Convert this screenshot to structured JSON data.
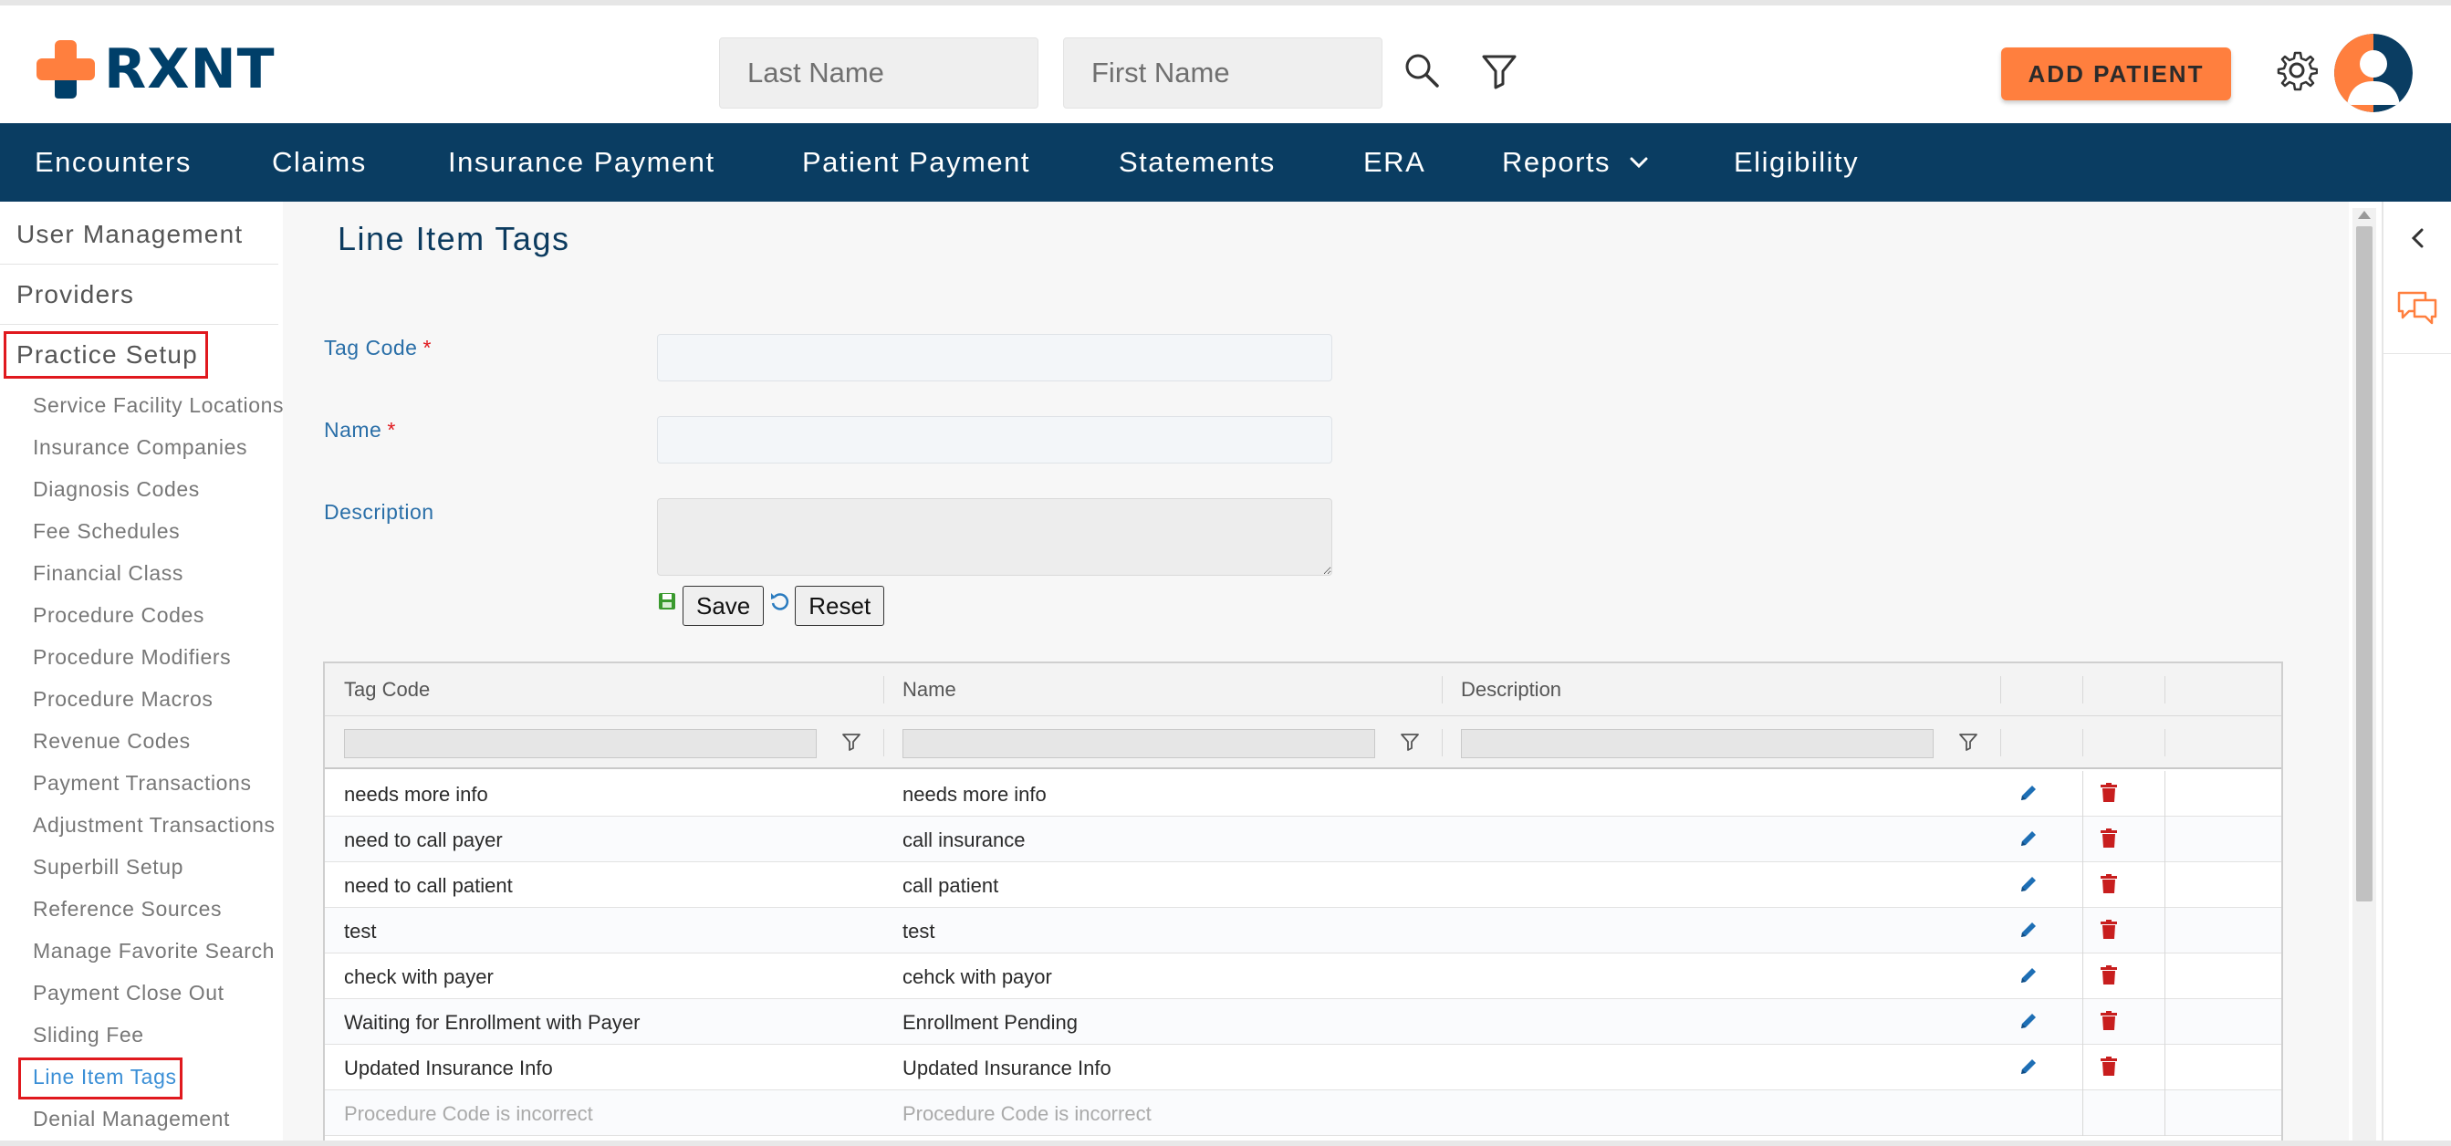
{
  "app": {
    "logo_text": "RXNT",
    "brand_color": "#003f69",
    "accent_color": "#ff7f3e",
    "nav_color": "#0a3d62"
  },
  "header": {
    "last_name_placeholder": "Last Name",
    "first_name_placeholder": "First Name",
    "add_patient_label": "ADD PATIENT",
    "icons": [
      "search-icon",
      "filter-icon",
      "gear-icon",
      "avatar"
    ]
  },
  "nav": {
    "items": [
      {
        "label": "Encounters"
      },
      {
        "label": "Claims"
      },
      {
        "label": "Insurance Payment"
      },
      {
        "label": "Patient Payment"
      },
      {
        "label": "Statements"
      },
      {
        "label": "ERA"
      },
      {
        "label": "Reports"
      },
      {
        "label": "Eligibility"
      }
    ]
  },
  "sidebar": {
    "top_items": [
      {
        "label": "User Management"
      },
      {
        "label": "Providers"
      },
      {
        "label": "Practice Setup"
      }
    ],
    "sub_items": [
      {
        "label": "Service Facility Locations"
      },
      {
        "label": "Insurance Companies"
      },
      {
        "label": "Diagnosis Codes"
      },
      {
        "label": "Fee Schedules"
      },
      {
        "label": "Financial Class"
      },
      {
        "label": "Procedure Codes"
      },
      {
        "label": "Procedure Modifiers"
      },
      {
        "label": "Procedure Macros"
      },
      {
        "label": "Revenue Codes"
      },
      {
        "label": "Payment Transactions"
      },
      {
        "label": "Adjustment Transactions"
      },
      {
        "label": "Superbill Setup"
      },
      {
        "label": "Reference Sources"
      },
      {
        "label": "Manage Favorite Search"
      },
      {
        "label": "Payment Close Out"
      },
      {
        "label": "Sliding Fee"
      },
      {
        "label": "Line Item Tags"
      },
      {
        "label": "Denial Management"
      }
    ],
    "active_item": "Line Item Tags"
  },
  "main": {
    "title": "Line Item Tags",
    "form": {
      "tag_code_label": "Tag Code",
      "name_label": "Name",
      "description_label": "Description",
      "required_mark": "*",
      "tag_code_value": "",
      "name_value": "",
      "description_value": "",
      "save_label": "Save",
      "reset_label": "Reset"
    },
    "grid": {
      "columns": [
        "Tag Code",
        "Name",
        "Description"
      ],
      "rows": [
        {
          "tag_code": "needs more info",
          "name": "needs more info",
          "description": ""
        },
        {
          "tag_code": "need to call payer",
          "name": "call insurance",
          "description": ""
        },
        {
          "tag_code": "need to call patient",
          "name": "call patient",
          "description": ""
        },
        {
          "tag_code": "test",
          "name": "test",
          "description": ""
        },
        {
          "tag_code": "check with payer",
          "name": "cehck with payor",
          "description": ""
        },
        {
          "tag_code": "Waiting for Enrollment with Payer",
          "name": "Enrollment Pending",
          "description": ""
        },
        {
          "tag_code": "Updated Insurance Info",
          "name": "Updated Insurance Info",
          "description": ""
        },
        {
          "tag_code": "Procedure Code is incorrect",
          "name": "Procedure Code is incorrect",
          "description": ""
        }
      ]
    }
  }
}
